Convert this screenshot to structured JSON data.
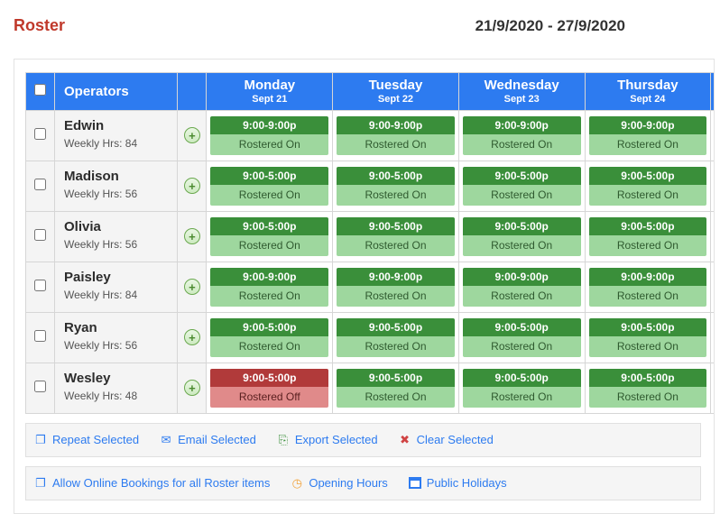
{
  "page_title": "Roster",
  "date_range": "21/9/2020 - 27/9/2020",
  "columns": {
    "operators_header": "Operators",
    "days": [
      {
        "name": "Monday",
        "date": "Sept 21"
      },
      {
        "name": "Tuesday",
        "date": "Sept 22"
      },
      {
        "name": "Wednesday",
        "date": "Sept 23"
      },
      {
        "name": "Thursday",
        "date": "Sept 24"
      }
    ]
  },
  "weekly_hrs_label_prefix": "Weekly Hrs: ",
  "operators": [
    {
      "name": "Edwin",
      "weekly_hrs": 84,
      "slots": [
        {
          "time": "9:00-9:00p",
          "status": "Rostered On",
          "state": "on"
        },
        {
          "time": "9:00-9:00p",
          "status": "Rostered On",
          "state": "on"
        },
        {
          "time": "9:00-9:00p",
          "status": "Rostered On",
          "state": "on"
        },
        {
          "time": "9:00-9:00p",
          "status": "Rostered On",
          "state": "on"
        }
      ]
    },
    {
      "name": "Madison",
      "weekly_hrs": 56,
      "slots": [
        {
          "time": "9:00-5:00p",
          "status": "Rostered On",
          "state": "on"
        },
        {
          "time": "9:00-5:00p",
          "status": "Rostered On",
          "state": "on"
        },
        {
          "time": "9:00-5:00p",
          "status": "Rostered On",
          "state": "on"
        },
        {
          "time": "9:00-5:00p",
          "status": "Rostered On",
          "state": "on"
        }
      ]
    },
    {
      "name": "Olivia",
      "weekly_hrs": 56,
      "slots": [
        {
          "time": "9:00-5:00p",
          "status": "Rostered On",
          "state": "on"
        },
        {
          "time": "9:00-5:00p",
          "status": "Rostered On",
          "state": "on"
        },
        {
          "time": "9:00-5:00p",
          "status": "Rostered On",
          "state": "on"
        },
        {
          "time": "9:00-5:00p",
          "status": "Rostered On",
          "state": "on"
        }
      ]
    },
    {
      "name": "Paisley",
      "weekly_hrs": 84,
      "slots": [
        {
          "time": "9:00-9:00p",
          "status": "Rostered On",
          "state": "on"
        },
        {
          "time": "9:00-9:00p",
          "status": "Rostered On",
          "state": "on"
        },
        {
          "time": "9:00-9:00p",
          "status": "Rostered On",
          "state": "on"
        },
        {
          "time": "9:00-9:00p",
          "status": "Rostered On",
          "state": "on"
        }
      ]
    },
    {
      "name": "Ryan",
      "weekly_hrs": 56,
      "slots": [
        {
          "time": "9:00-5:00p",
          "status": "Rostered On",
          "state": "on"
        },
        {
          "time": "9:00-5:00p",
          "status": "Rostered On",
          "state": "on"
        },
        {
          "time": "9:00-5:00p",
          "status": "Rostered On",
          "state": "on"
        },
        {
          "time": "9:00-5:00p",
          "status": "Rostered On",
          "state": "on"
        }
      ]
    },
    {
      "name": "Wesley",
      "weekly_hrs": 48,
      "slots": [
        {
          "time": "9:00-5:00p",
          "status": "Rostered Off",
          "state": "off"
        },
        {
          "time": "9:00-5:00p",
          "status": "Rostered On",
          "state": "on"
        },
        {
          "time": "9:00-5:00p",
          "status": "Rostered On",
          "state": "on"
        },
        {
          "time": "9:00-5:00p",
          "status": "Rostered On",
          "state": "on"
        }
      ]
    }
  ],
  "actions": {
    "repeat_selected": "Repeat Selected",
    "email_selected": "Email Selected",
    "export_selected": "Export Selected",
    "clear_selected": "Clear Selected",
    "allow_online_bookings": "Allow Online Bookings for all Roster items",
    "opening_hours": "Opening Hours",
    "public_holidays": "Public Holidays"
  }
}
